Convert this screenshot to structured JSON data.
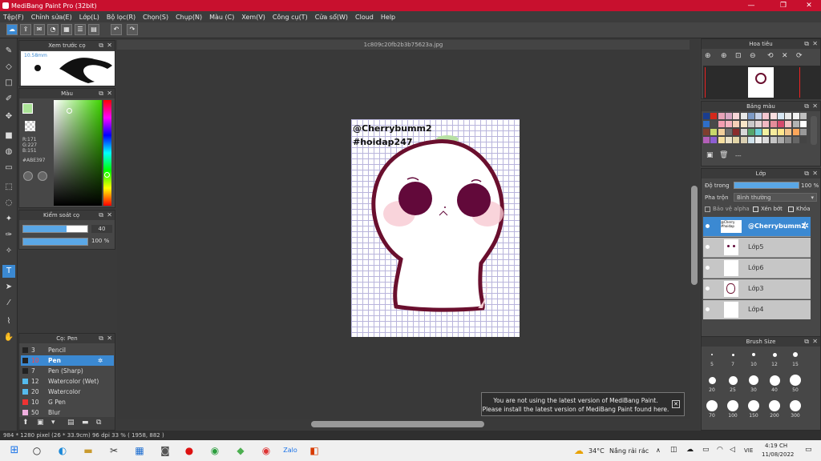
{
  "window": {
    "title": "MediBang Paint Pro (32bit)",
    "minimize": "—",
    "maximize": "❐",
    "close": "✕"
  },
  "menu": [
    "Tệp(F)",
    "Chỉnh sửa(E)",
    "Lớp(L)",
    "Bộ lọc(R)",
    "Chọn(S)",
    "Chụp(N)",
    "Màu (C)",
    "Xem(V)",
    "Công cụ(T)",
    "Cửa sổ(W)",
    "Cloud",
    "Help"
  ],
  "document": {
    "tab_name": "1c809c20fb2b3b75623a.jpg",
    "watermark_line1": "@Cherrybumm2",
    "watermark_line2": "#hoidap247"
  },
  "brush_preview": {
    "title": "Xem trước cọ",
    "size_label": "10.58mm"
  },
  "color_panel": {
    "title": "Màu",
    "r": "R:171",
    "g": "G:227",
    "b": "B:151",
    "hex": "#ABE397",
    "current_color": "#abe397"
  },
  "brush_control": {
    "title": "Kiểm soát cọ",
    "size_value": "40",
    "opacity_value": "100 %",
    "size_fraction": 0.67,
    "opacity_fraction": 1.0
  },
  "brush_list": {
    "title": "Cọ: Pen",
    "items": [
      {
        "size": "3",
        "name": "Pencil",
        "color": "#222222"
      },
      {
        "size": "10",
        "name": "Pen",
        "color": "#222222"
      },
      {
        "size": "7",
        "name": "Pen (Sharp)",
        "color": "#222222"
      },
      {
        "size": "12",
        "name": "Watercolor (Wet)",
        "color": "#55bbee"
      },
      {
        "size": "20",
        "name": "Watercolor",
        "color": "#55bbee"
      },
      {
        "size": "10",
        "name": "G Pen",
        "color": "#ee3333"
      },
      {
        "size": "50",
        "name": "Blur",
        "color": "#dddddd"
      }
    ]
  },
  "navigator": {
    "title": "Hoa tiêu"
  },
  "palette": {
    "title": "Bảng màu",
    "menu_label": "---",
    "colors": [
      "#1a3d8f",
      "#d4281b",
      "#e8a3b8",
      "#d9a8c4",
      "#f7d6d8",
      "#e8e8e8",
      "#7d9ac6",
      "#c7d1e8",
      "#f4c7cf",
      "#f9dfe0",
      "#d8e8f4",
      "#eaeaea",
      "#f2f2f2",
      "#bfbfbf",
      "#2e6ec9",
      "#4a4a4a",
      "#f29db0",
      "#f5b3c0",
      "#f7d0b8",
      "#f7e6c8",
      "#c9c9c9",
      "#e3d5d5",
      "#f0b8c2",
      "#e58d9a",
      "#d44a6c",
      "#f2c2c2",
      "#b3b3b3",
      "#ffffff",
      "#7f3f2f",
      "#c8d86a",
      "#f2cf9b",
      "#6e6e6e",
      "#8a2c2c",
      "#d8d8d8",
      "#56a56c",
      "#6dd0d8",
      "#f2f2a0",
      "#f7ec9d",
      "#ffe68c",
      "#f2c48a",
      "#fca65a",
      "#999999",
      "#b45fb8",
      "#8d5ed1",
      "#f7e0a0",
      "#ece3c8",
      "#e3d6a8",
      "#d9cfb2",
      "#cfe1ea",
      "#efefef",
      "#dcdcdc",
      "#c5c5c5",
      "#aaaaaa",
      "#888888",
      "#666666",
      "#444444"
    ]
  },
  "layers": {
    "title": "Lớp",
    "opacity_label": "Độ trong",
    "opacity_value": "100 %",
    "opacity_fraction": 1.0,
    "blend_label": "Pha trộn",
    "blend_value": "Bình thường",
    "protect_alpha": "Bảo vệ alpha",
    "clipping": "Xén bớt",
    "lock": "Khóa",
    "items": [
      {
        "name": "@Cherrybumm2"
      },
      {
        "name": "Lớp5"
      },
      {
        "name": "Lớp6"
      },
      {
        "name": "Lớp3"
      },
      {
        "name": "Lớp4"
      }
    ]
  },
  "brush_size": {
    "title": "Brush Size",
    "sizes": [
      "5",
      "7",
      "10",
      "12",
      "15",
      "20",
      "25",
      "30",
      "40",
      "50",
      "70",
      "100",
      "150",
      "200",
      "300"
    ]
  },
  "notification": {
    "line1": "You are not using the latest version of MediBang Paint.",
    "line2": "Please install the latest version of MediBang Paint found here."
  },
  "status": {
    "text": "984 * 1280 pixel   (26 * 33.9cm)   96 dpi   33 %   ( 1958, 882 )"
  },
  "taskbar": {
    "weather_temp": "34°C",
    "weather_text": "Nắng rải rác",
    "language": "VIE",
    "time": "4:19 CH",
    "date": "11/08/2022"
  }
}
